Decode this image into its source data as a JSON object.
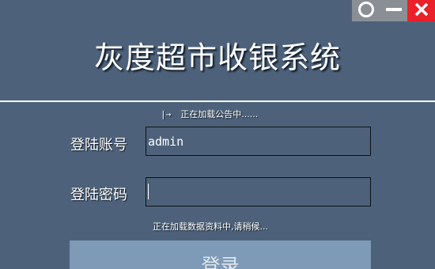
{
  "window": {
    "title": "灰度超市收银系统",
    "background": "#4d627a"
  },
  "controls": {
    "restore_icon": "circle-icon",
    "minimize_icon": "minimize-icon",
    "close_icon": "close-icon",
    "close_color": "#e8212a"
  },
  "notice": {
    "arrow": "|→",
    "text": "正在加载公告中......"
  },
  "form": {
    "account_label": "登陆账号",
    "account_value": "admin",
    "password_label": "登陆密码",
    "password_value": ""
  },
  "status": {
    "text": "正在加载数据资料中,请稍候..."
  },
  "login_button": {
    "label": "登录",
    "color": "#7e9ab7"
  }
}
